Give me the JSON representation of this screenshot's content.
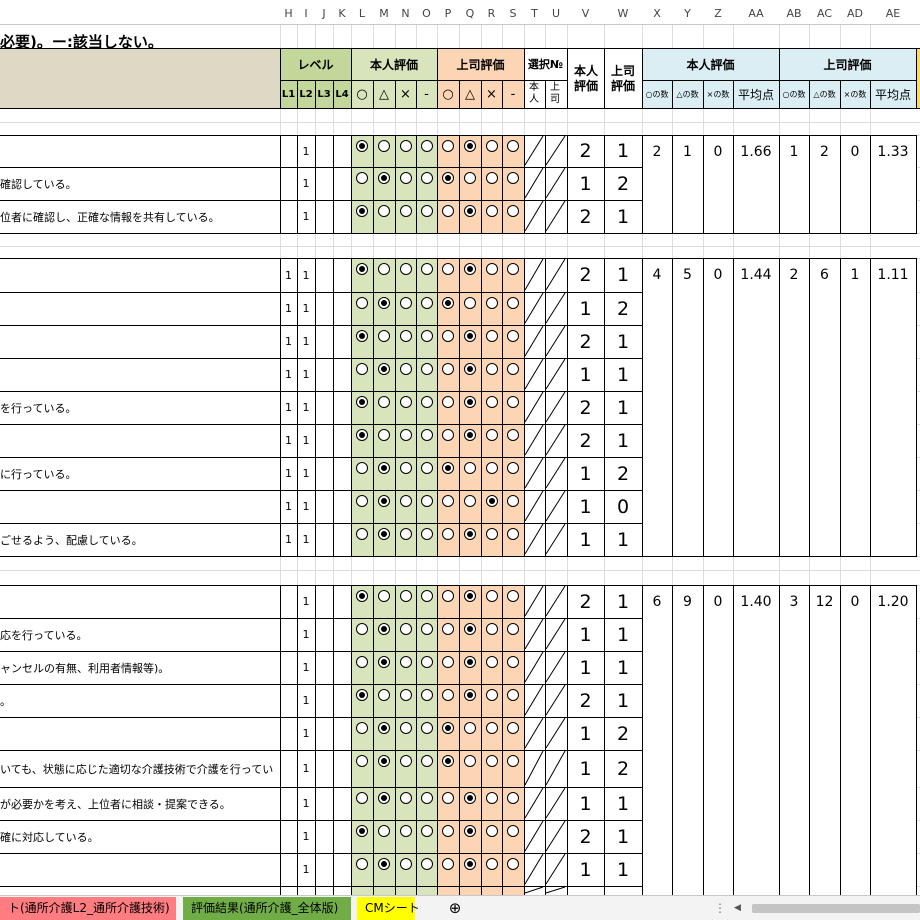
{
  "columns": [
    {
      "letter": "H",
      "l": 280,
      "r": 297
    },
    {
      "letter": "I",
      "l": 297,
      "r": 315
    },
    {
      "letter": "J",
      "l": 315,
      "r": 333
    },
    {
      "letter": "K",
      "l": 333,
      "r": 351
    },
    {
      "letter": "L",
      "l": 351,
      "r": 373
    },
    {
      "letter": "M",
      "l": 373,
      "r": 395
    },
    {
      "letter": "N",
      "l": 395,
      "r": 416
    },
    {
      "letter": "O",
      "l": 416,
      "r": 437
    },
    {
      "letter": "P",
      "l": 437,
      "r": 459
    },
    {
      "letter": "Q",
      "l": 459,
      "r": 481
    },
    {
      "letter": "R",
      "l": 481,
      "r": 502
    },
    {
      "letter": "S",
      "l": 502,
      "r": 524
    },
    {
      "letter": "T",
      "l": 524,
      "r": 545
    },
    {
      "letter": "U",
      "l": 545,
      "r": 567
    },
    {
      "letter": "V",
      "l": 567,
      "r": 604
    },
    {
      "letter": "W",
      "l": 604,
      "r": 642
    },
    {
      "letter": "X",
      "l": 642,
      "r": 672
    },
    {
      "letter": "Y",
      "l": 672,
      "r": 703
    },
    {
      "letter": "Z",
      "l": 703,
      "r": 733
    },
    {
      "letter": "AA",
      "l": 733,
      "r": 779
    },
    {
      "letter": "AB",
      "l": 779,
      "r": 809
    },
    {
      "letter": "AC",
      "l": 809,
      "r": 840
    },
    {
      "letter": "AD",
      "l": 840,
      "r": 870
    },
    {
      "letter": "AE",
      "l": 870,
      "r": 916
    }
  ],
  "title": "必要)。ー:該当しない。",
  "header": {
    "level": "レベル",
    "self_eval": "本人評価",
    "boss_eval": "上司評価",
    "select_no": "選択№",
    "self_score": "本人評価",
    "boss_score": "上司評価",
    "self_summary": "本人評価",
    "boss_summary": "上司評価",
    "levels": [
      "L1",
      "L2",
      "L3",
      "L4"
    ],
    "marks": [
      "○",
      "△",
      "×",
      "-"
    ],
    "sel_self": "本人",
    "sel_boss": "上司",
    "count_o": "○の数",
    "count_t": "△の数",
    "count_x": "×の数",
    "avg": "平均点"
  },
  "colors": {
    "level_header": "#c4d79b",
    "self_eval": "#d8e4bc",
    "boss_eval": "#fcd5b4",
    "summary": "#daeef3",
    "title_band": "#ddd9c4",
    "score_header": "#ffffff",
    "tab_red": "#ff7c80",
    "tab_green": "#70ad47",
    "tab_yellow": "#ffff00"
  },
  "rows": [
    {
      "desc": "",
      "levels": [
        "",
        "1",
        "",
        ""
      ],
      "self": 0,
      "boss": 1,
      "self_score": "2",
      "boss_score": "1"
    },
    {
      "desc": "確認している。",
      "levels": [
        "",
        "1",
        "",
        ""
      ],
      "self": 1,
      "boss": 0,
      "self_score": "1",
      "boss_score": "2"
    },
    {
      "desc": "位者に確認し、正確な情報を共有している。",
      "levels": [
        "",
        "1",
        "",
        ""
      ],
      "self": 0,
      "boss": 1,
      "self_score": "2",
      "boss_score": "1"
    },
    {
      "desc": "",
      "levels": [
        "1",
        "1",
        "",
        ""
      ],
      "self": 0,
      "boss": 1,
      "self_score": "2",
      "boss_score": "1"
    },
    {
      "desc": "",
      "levels": [
        "1",
        "1",
        "",
        ""
      ],
      "self": 1,
      "boss": 0,
      "self_score": "1",
      "boss_score": "2"
    },
    {
      "desc": "",
      "levels": [
        "1",
        "1",
        "",
        ""
      ],
      "self": 0,
      "boss": 1,
      "self_score": "2",
      "boss_score": "1"
    },
    {
      "desc": "",
      "levels": [
        "1",
        "1",
        "",
        ""
      ],
      "self": 1,
      "boss": 1,
      "self_score": "1",
      "boss_score": "1"
    },
    {
      "desc": "を行っている。",
      "levels": [
        "1",
        "1",
        "",
        ""
      ],
      "self": 0,
      "boss": 1,
      "self_score": "2",
      "boss_score": "1"
    },
    {
      "desc": "",
      "levels": [
        "1",
        "1",
        "",
        ""
      ],
      "self": 0,
      "boss": 1,
      "self_score": "2",
      "boss_score": "1"
    },
    {
      "desc": "に行っている。",
      "levels": [
        "1",
        "1",
        "",
        ""
      ],
      "self": 1,
      "boss": 0,
      "self_score": "1",
      "boss_score": "2"
    },
    {
      "desc": "",
      "levels": [
        "1",
        "1",
        "",
        ""
      ],
      "self": 1,
      "boss": 2,
      "self_score": "1",
      "boss_score": "0"
    },
    {
      "desc": "ごせるよう、配慮している。",
      "levels": [
        "1",
        "1",
        "",
        ""
      ],
      "self": 1,
      "boss": 1,
      "self_score": "1",
      "boss_score": "1"
    },
    {
      "desc": "",
      "levels": [
        "",
        "1",
        "",
        ""
      ],
      "self": 0,
      "boss": 1,
      "self_score": "2",
      "boss_score": "1"
    },
    {
      "desc": "応を行っている。",
      "levels": [
        "",
        "1",
        "",
        ""
      ],
      "self": 1,
      "boss": 1,
      "self_score": "1",
      "boss_score": "1"
    },
    {
      "desc": "ャンセルの有無、利用者情報等)。",
      "levels": [
        "",
        "1",
        "",
        ""
      ],
      "self": 1,
      "boss": 1,
      "self_score": "1",
      "boss_score": "1"
    },
    {
      "desc": "。",
      "levels": [
        "",
        "1",
        "",
        ""
      ],
      "self": 0,
      "boss": 1,
      "self_score": "2",
      "boss_score": "1"
    },
    {
      "desc": "",
      "levels": [
        "",
        "1",
        "",
        ""
      ],
      "self": 1,
      "boss": 0,
      "self_score": "1",
      "boss_score": "2"
    },
    {
      "desc": "いても、状態に応じた適切な介護技術で介護を行ってい",
      "levels": [
        "",
        "1",
        "",
        ""
      ],
      "self": 1,
      "boss": 0,
      "self_score": "1",
      "boss_score": "2"
    },
    {
      "desc": "が必要かを考え、上位者に相談・提案できる。",
      "levels": [
        "",
        "1",
        "",
        ""
      ],
      "self": 1,
      "boss": 1,
      "self_score": "1",
      "boss_score": "1"
    },
    {
      "desc": "確に対応している。",
      "levels": [
        "",
        "1",
        "",
        ""
      ],
      "self": 0,
      "boss": 1,
      "self_score": "2",
      "boss_score": "1"
    },
    {
      "desc": "",
      "levels": [
        "",
        "1",
        "",
        ""
      ],
      "self": 1,
      "boss": 1,
      "self_score": "1",
      "boss_score": "1"
    },
    {
      "desc": "",
      "levels": [
        "",
        "",
        "",
        ""
      ],
      "self": -1,
      "boss": -1,
      "self_score": "",
      "boss_score": ""
    }
  ],
  "summaries": [
    {
      "self": [
        "2",
        "1",
        "0",
        "1.66"
      ],
      "boss": [
        "1",
        "2",
        "0",
        "1.33"
      ]
    },
    {
      "self": [
        "4",
        "5",
        "0",
        "1.44"
      ],
      "boss": [
        "2",
        "6",
        "1",
        "1.11"
      ]
    },
    {
      "self": [
        "6",
        "9",
        "0",
        "1.40"
      ],
      "boss": [
        "3",
        "12",
        "0",
        "1.20"
      ]
    }
  ],
  "tabs": [
    {
      "label": "ト(通所介護L2_通所介護技術)"
    },
    {
      "label": "評価結果(通所介護_全体版)"
    },
    {
      "label": "CMシート"
    }
  ]
}
